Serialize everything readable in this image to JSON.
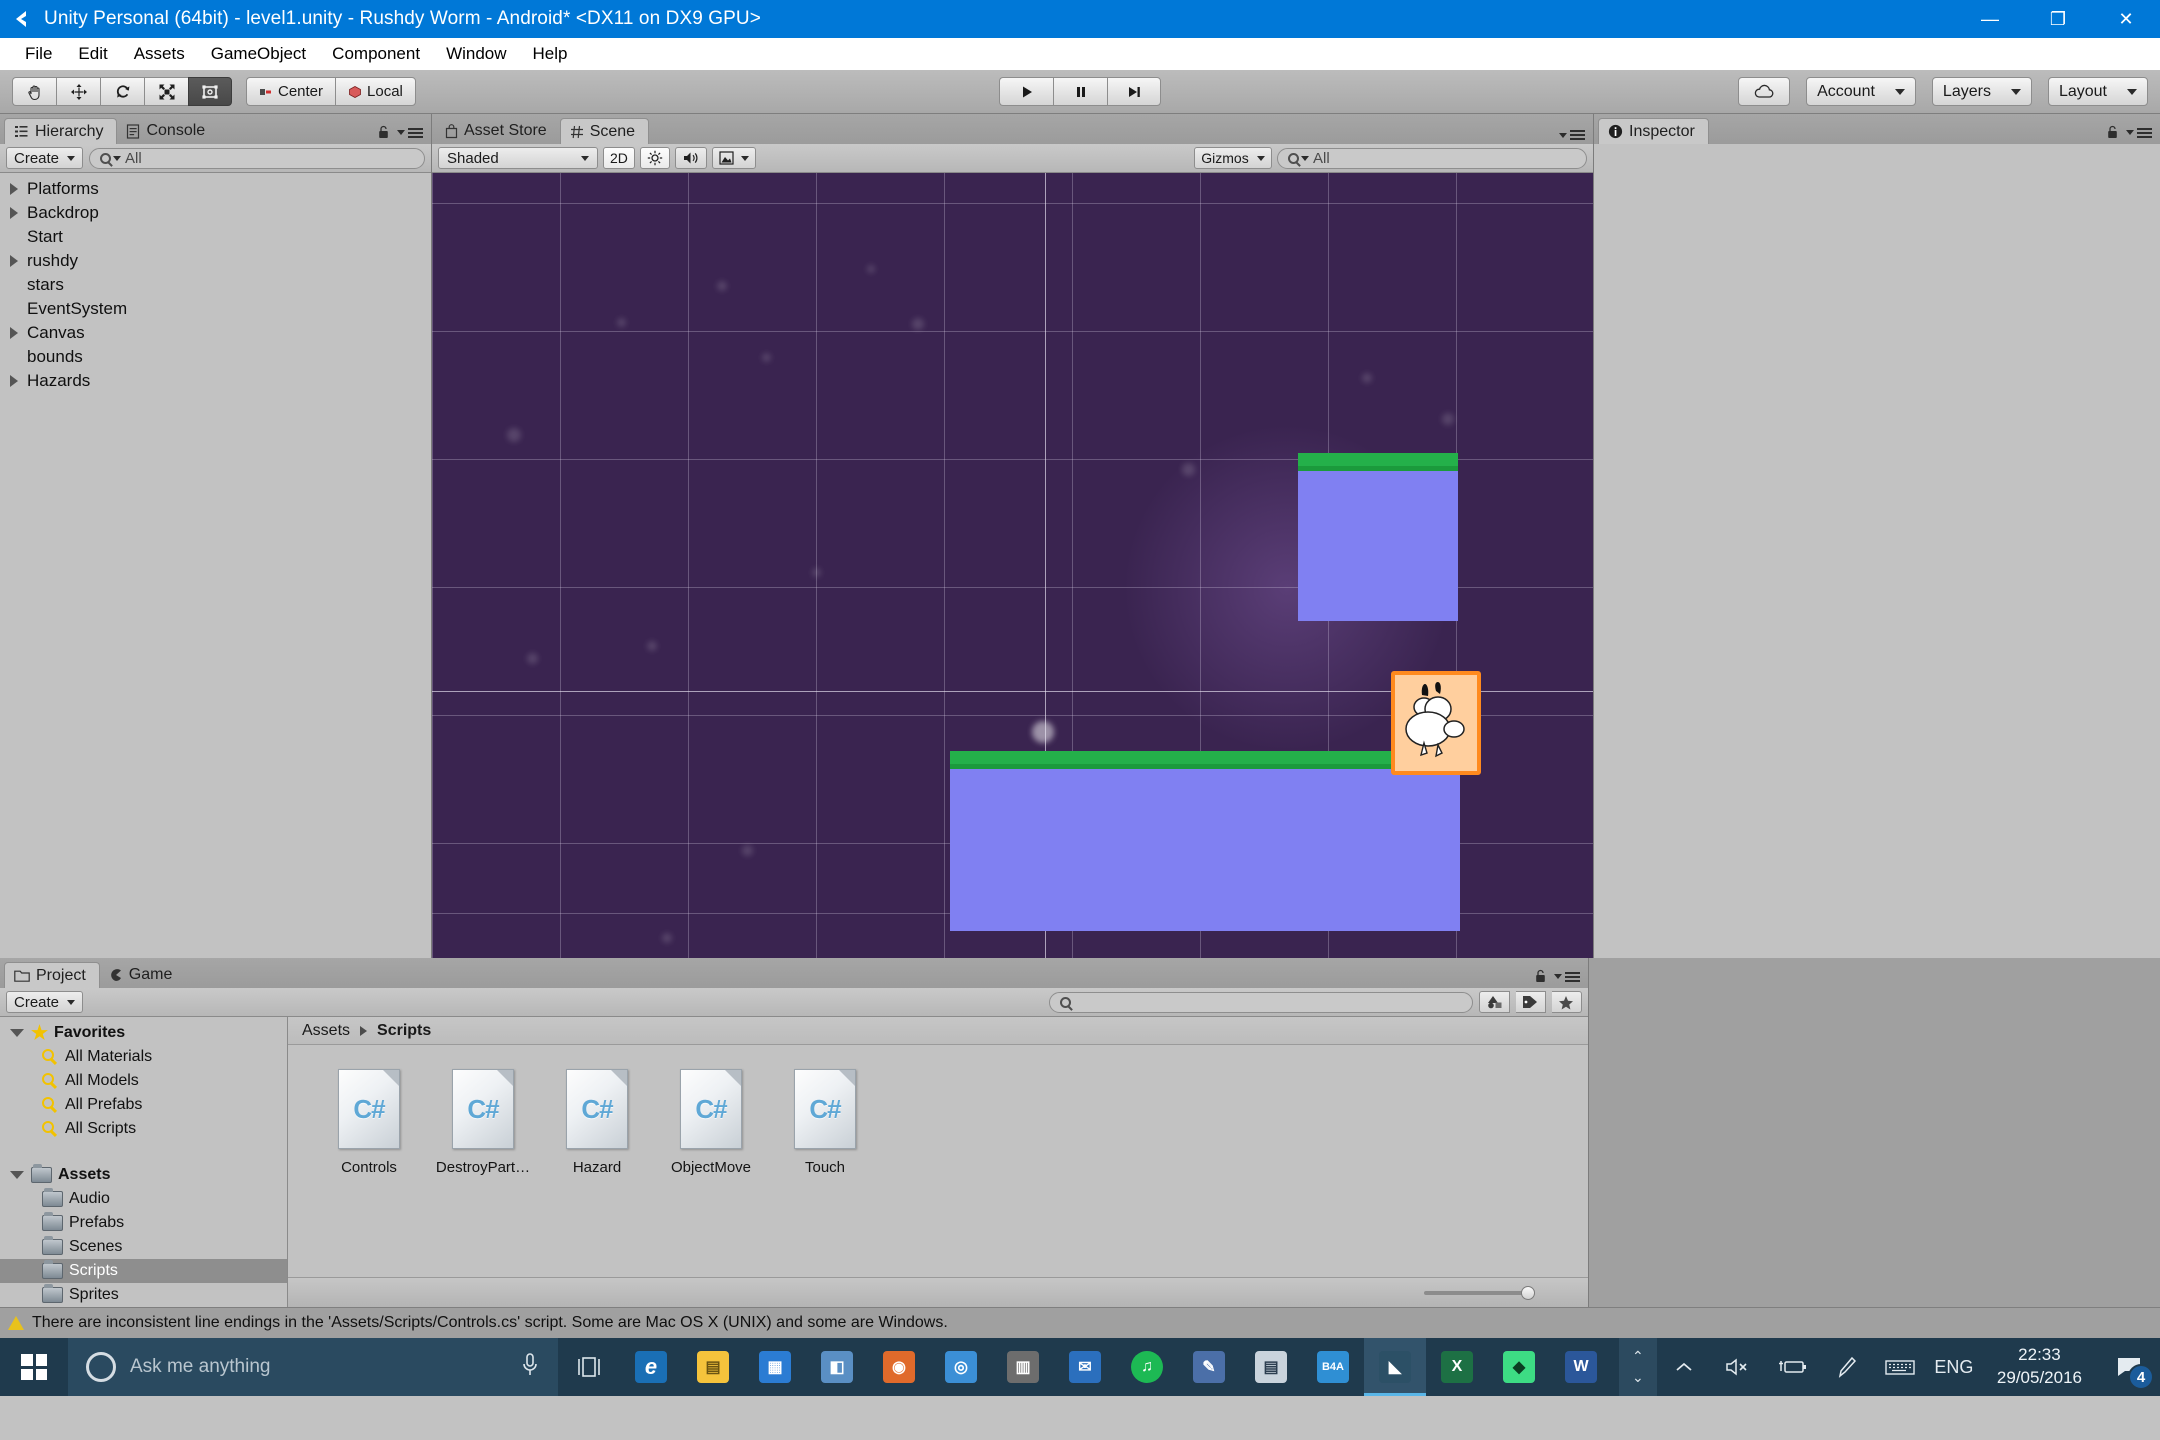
{
  "window": {
    "title": "Unity Personal (64bit) - level1.unity - Rushdy Worm - Android* <DX11 on DX9 GPU>",
    "app_icon": "unity-icon",
    "minimize": "—",
    "maximize": "❐",
    "close": "✕"
  },
  "menubar": {
    "items": [
      "File",
      "Edit",
      "Assets",
      "GameObject",
      "Component",
      "Window",
      "Help"
    ]
  },
  "toolbar": {
    "transform_tools": [
      {
        "name": "hand-tool",
        "icon": "hand-icon",
        "active": false
      },
      {
        "name": "move-tool",
        "icon": "move-icon",
        "active": false
      },
      {
        "name": "rotate-tool",
        "icon": "rotate-icon",
        "active": false
      },
      {
        "name": "scale-tool",
        "icon": "scale-icon",
        "active": false
      },
      {
        "name": "rect-tool",
        "icon": "rect-transform-icon",
        "active": true
      }
    ],
    "pivot_label": "Center",
    "rotation_label": "Local",
    "play_label": "▶",
    "pause_label": "❚❚",
    "step_label": "▶❙",
    "cloud_label": "cloud-icon",
    "account_label": "Account",
    "layers_label": "Layers",
    "layout_label": "Layout"
  },
  "hierarchy": {
    "tabs": [
      {
        "label": "Hierarchy",
        "icon": "hierarchy-icon",
        "active": true
      },
      {
        "label": "Console",
        "icon": "console-icon",
        "active": false
      }
    ],
    "create_label": "Create",
    "search_placeholder": "All",
    "items": [
      {
        "label": "Platforms",
        "expandable": true
      },
      {
        "label": "Backdrop",
        "expandable": true
      },
      {
        "label": "Start",
        "expandable": false
      },
      {
        "label": "rushdy",
        "expandable": true
      },
      {
        "label": "stars",
        "expandable": false
      },
      {
        "label": "EventSystem",
        "expandable": false
      },
      {
        "label": "Canvas",
        "expandable": true
      },
      {
        "label": "bounds",
        "expandable": false
      },
      {
        "label": "Hazards",
        "expandable": true
      }
    ]
  },
  "scene": {
    "tabs": [
      {
        "label": "Asset Store",
        "icon": "asset-store-icon",
        "active": false
      },
      {
        "label": "Scene",
        "icon": "scene-icon",
        "active": true
      }
    ],
    "draw_mode": "Shaded",
    "mode_2d": "2D",
    "lighting_icon": "sun-icon",
    "audio_icon": "speaker-icon",
    "effects_icon": "image-icon",
    "gizmos_label": "Gizmos",
    "search_placeholder": "All",
    "background_color": "#3a2450",
    "platform_color": "#8080f2",
    "platform_top_color": "#24b04a",
    "selection_color": "#ff8a1e"
  },
  "inspector": {
    "tab_label": "Inspector",
    "tab_icon": "info-icon"
  },
  "project": {
    "tabs": [
      {
        "label": "Project",
        "icon": "folder-icon",
        "active": true
      },
      {
        "label": "Game",
        "icon": "game-icon",
        "active": false
      }
    ],
    "create_label": "Create",
    "search_placeholder": "",
    "tree": [
      {
        "label": "Favorites",
        "type": "root-star",
        "depth": 0,
        "selected": false
      },
      {
        "label": "All Materials",
        "type": "search",
        "depth": 1,
        "selected": false
      },
      {
        "label": "All Models",
        "type": "search",
        "depth": 1,
        "selected": false
      },
      {
        "label": "All Prefabs",
        "type": "search",
        "depth": 1,
        "selected": false
      },
      {
        "label": "All Scripts",
        "type": "search",
        "depth": 1,
        "selected": false
      },
      {
        "label": "Assets",
        "type": "root-folder",
        "depth": 0,
        "selected": false
      },
      {
        "label": "Audio",
        "type": "folder",
        "depth": 1,
        "selected": false
      },
      {
        "label": "Prefabs",
        "type": "folder",
        "depth": 1,
        "selected": false
      },
      {
        "label": "Scenes",
        "type": "folder",
        "depth": 1,
        "selected": false
      },
      {
        "label": "Scripts",
        "type": "folder",
        "depth": 1,
        "selected": true
      },
      {
        "label": "Sprites",
        "type": "folder",
        "depth": 1,
        "selected": false
      }
    ],
    "breadcrumb": [
      "Assets",
      "Scripts"
    ],
    "assets": [
      {
        "label": "Controls",
        "type": "C#"
      },
      {
        "label": "DestroyPart…",
        "type": "C#"
      },
      {
        "label": "Hazard",
        "type": "C#"
      },
      {
        "label": "ObjectMove",
        "type": "C#"
      },
      {
        "label": "Touch",
        "type": "C#"
      }
    ]
  },
  "statusbar": {
    "icon": "warning-icon",
    "message": "There are inconsistent line endings in the 'Assets/Scripts/Controls.cs' script. Some are Mac OS X (UNIX) and some are Windows."
  },
  "taskbar": {
    "start_icon": "windows-logo-icon",
    "search_placeholder": "Ask me anything",
    "cortana_icon": "cortana-ring-icon",
    "mic_icon": "microphone-icon",
    "taskview_icon": "task-view-icon",
    "apps": [
      {
        "name": "edge",
        "glyph": "e",
        "color": "#1a6fb5",
        "active": false
      },
      {
        "name": "file-explorer",
        "glyph": "▤",
        "color": "#f5c33c",
        "active": false
      },
      {
        "name": "store",
        "glyph": "▦",
        "color": "#2b7cd3",
        "active": false
      },
      {
        "name": "photos",
        "glyph": "◧",
        "color": "#5a8fc4",
        "active": false
      },
      {
        "name": "groove-music",
        "glyph": "◉",
        "color": "#e06a2b",
        "active": false
      },
      {
        "name": "browser",
        "glyph": "◎",
        "color": "#3b8fd6",
        "active": false
      },
      {
        "name": "calculator",
        "glyph": "▥",
        "color": "#6d6d6d",
        "active": false
      },
      {
        "name": "mail",
        "glyph": "✉",
        "color": "#2b6fbd",
        "active": false
      },
      {
        "name": "spotify",
        "glyph": "♫",
        "color": "#1db954",
        "active": false
      },
      {
        "name": "paint",
        "glyph": "✎",
        "color": "#4b6fa8",
        "active": false
      },
      {
        "name": "calendar",
        "glyph": "▤",
        "color": "#c9d3dc",
        "active": false
      },
      {
        "name": "b4a",
        "glyph": "B4A",
        "color": "#2f8fd4",
        "active": false
      },
      {
        "name": "unity",
        "glyph": "◣",
        "color": "#2c5066",
        "active": true
      },
      {
        "name": "excel",
        "glyph": "X",
        "color": "#1d7044",
        "active": false
      },
      {
        "name": "android-studio",
        "glyph": "◆",
        "color": "#3ddc84",
        "active": false
      },
      {
        "name": "word",
        "glyph": "W",
        "color": "#2b579a",
        "active": false
      }
    ],
    "tray": {
      "show_hidden": "⌃",
      "volume": "volume-muted-icon",
      "battery": "battery-charging-icon",
      "pen": "pen-icon",
      "keyboard": "keyboard-icon",
      "language": "ENG",
      "time": "22:33",
      "date": "29/05/2016",
      "action_center": "action-center-icon",
      "notification_count": "4"
    }
  }
}
